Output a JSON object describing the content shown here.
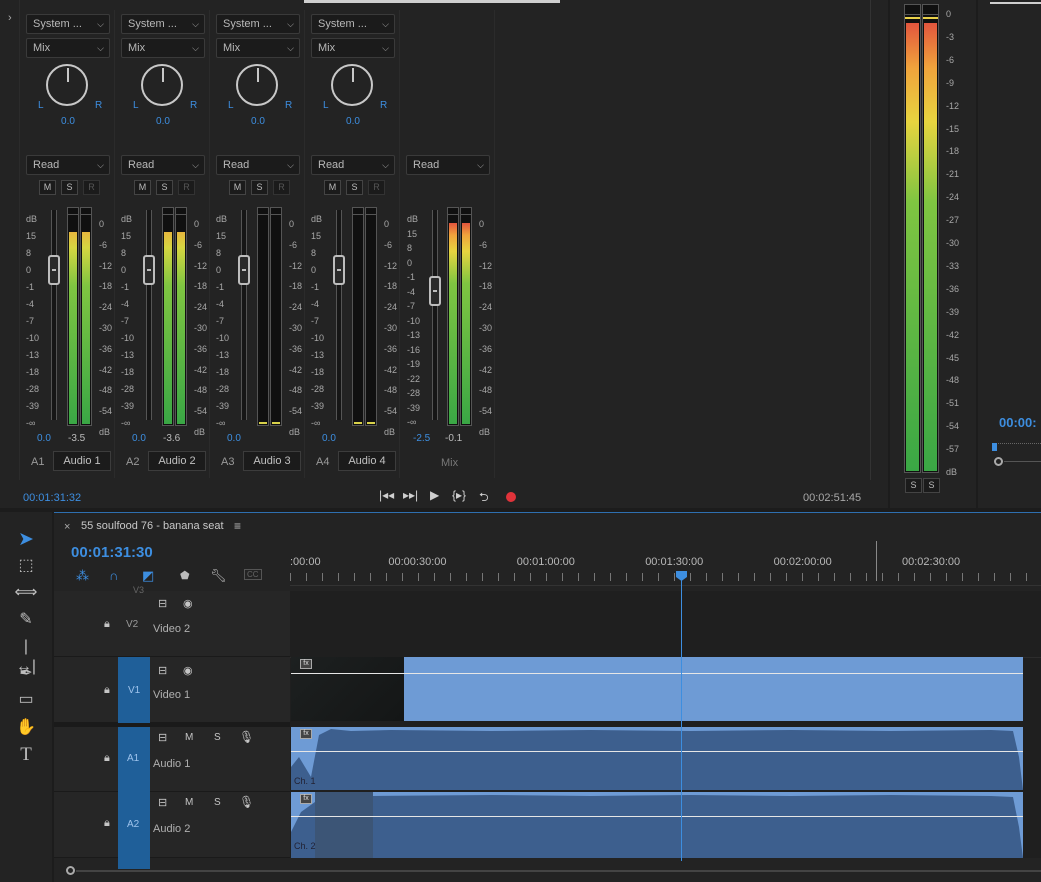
{
  "mixer": {
    "channels": [
      {
        "input": "System ...",
        "mode": "Mix",
        "pan_l": "L",
        "pan_r": "R",
        "pan_value": "0.0",
        "automation": "Read",
        "m": "M",
        "s": "S",
        "r": "R",
        "volume": "0.0",
        "peak": "-3.5",
        "id": "A1",
        "name": "Audio 1",
        "level": 0.93
      },
      {
        "input": "System ...",
        "mode": "Mix",
        "pan_l": "L",
        "pan_r": "R",
        "pan_value": "0.0",
        "automation": "Read",
        "m": "M",
        "s": "S",
        "r": "R",
        "volume": "0.0",
        "peak": "-3.6",
        "id": "A2",
        "name": "Audio 2",
        "level": 0.93
      },
      {
        "input": "System ...",
        "mode": "Mix",
        "pan_l": "L",
        "pan_r": "R",
        "pan_value": "0.0",
        "automation": "Read",
        "m": "M",
        "s": "S",
        "r": "R",
        "volume": "0.0",
        "peak": "",
        "id": "A3",
        "name": "Audio 3",
        "level": 0.0
      },
      {
        "input": "System ...",
        "mode": "Mix",
        "pan_l": "L",
        "pan_r": "R",
        "pan_value": "0.0",
        "automation": "Read",
        "m": "M",
        "s": "S",
        "r": "R",
        "volume": "0.0",
        "peak": "",
        "id": "A4",
        "name": "Audio 4",
        "level": 0.0
      }
    ],
    "mix": {
      "automation": "Read",
      "volume": "-2.5",
      "peak": "-0.1",
      "name": "Mix",
      "level": 0.97
    },
    "fader_scale": [
      "dB",
      "15",
      "8",
      "0",
      "-1",
      "-4",
      "-7",
      "-10",
      "-13",
      "-16",
      "-19",
      "-22",
      "-28",
      "-39",
      "-∞"
    ],
    "fader_scale_short": [
      "dB",
      "15",
      "8",
      "0",
      "-1",
      "-4",
      "-7",
      "-10",
      "-13",
      "-18",
      "-28",
      "-39",
      "-∞"
    ],
    "meter_scale": [
      "0",
      "-6",
      "-12",
      "-18",
      "-24",
      "-30",
      "-36",
      "-42",
      "-48",
      "-54",
      "dB"
    ],
    "current_time": "00:01:31:32",
    "duration": "00:02:51:45"
  },
  "master": {
    "scale": [
      "0",
      "-3",
      "-6",
      "-9",
      "-12",
      "-15",
      "-18",
      "-21",
      "-24",
      "-27",
      "-30",
      "-33",
      "-36",
      "-39",
      "-42",
      "-45",
      "-48",
      "-51",
      "-54",
      "-57",
      "dB"
    ],
    "solo_left": "S",
    "solo_right": "S"
  },
  "right_panel": {
    "timecode": "00:00:"
  },
  "timeline": {
    "sequence_name": "55 soulfood 76 - banana seat",
    "timecode": "00:01:31:30",
    "ruler": [
      ":00:00",
      "00:00:30:00",
      "00:01:00:00",
      "00:01:30:00",
      "00:02:00:00",
      "00:02:30:00"
    ],
    "tracks": [
      {
        "id": "V3",
        "name": "",
        "label": "V3"
      },
      {
        "id": "V2",
        "name": "Video 2",
        "label": "V2"
      },
      {
        "id": "V1",
        "name": "Video 1",
        "label": "V1"
      },
      {
        "id": "A1",
        "name": "Audio 1",
        "label": "A1",
        "m": "M",
        "s": "S",
        "channel": "Ch. 1"
      },
      {
        "id": "A2",
        "name": "Audio 2",
        "label": "A2",
        "m": "M",
        "s": "S",
        "channel": "Ch. 2"
      }
    ],
    "fx_badge": "fx"
  },
  "colors": {
    "accent": "#3d8ee0",
    "clip": "#6e9bd5",
    "target": "#1f5f99",
    "record": "#e0333a"
  }
}
